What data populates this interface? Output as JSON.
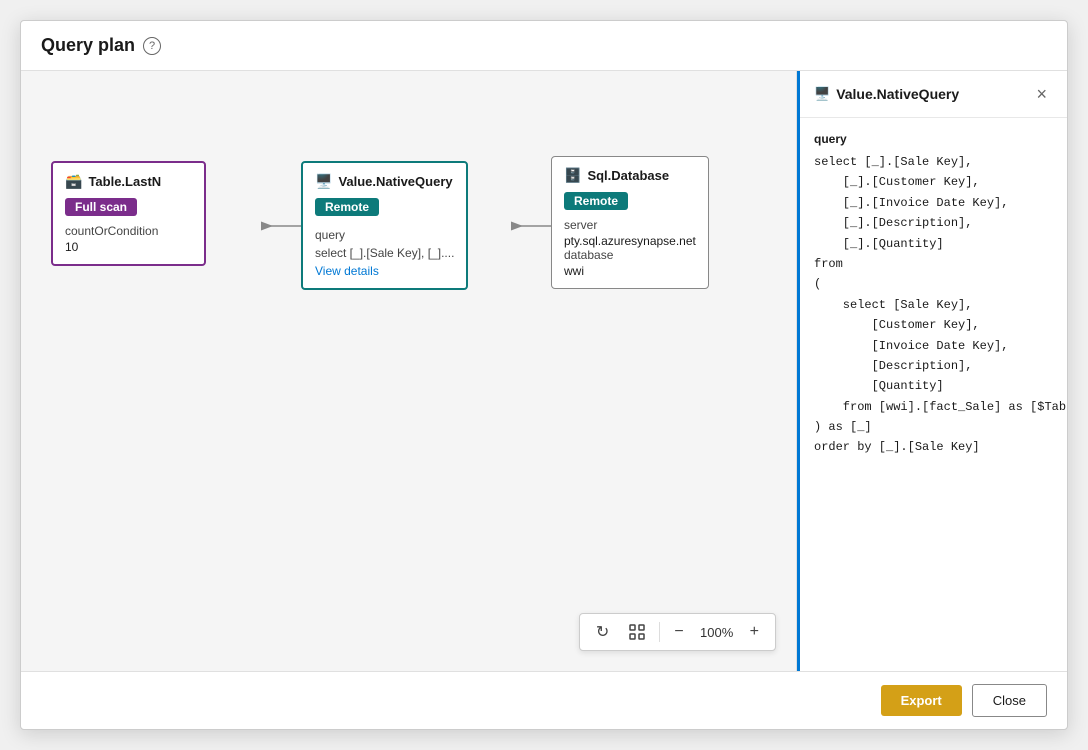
{
  "dialog": {
    "title": "Query plan",
    "help_tooltip": "?"
  },
  "footer": {
    "export_label": "Export",
    "close_label": "Close"
  },
  "canvas": {
    "zoom": "100%"
  },
  "nodes": [
    {
      "id": "table-lastn",
      "type": "table",
      "title": "Table.LastN",
      "badge": "Full scan",
      "badge_type": "fullscan",
      "fields": [
        {
          "label": "countOrCondition"
        },
        {
          "label": "10"
        }
      ]
    },
    {
      "id": "value-nativequery",
      "type": "value",
      "title": "Value.NativeQuery",
      "badge": "Remote",
      "badge_type": "remote",
      "query_label": "query",
      "query_preview": "select [_].[Sale Key], [_]....",
      "view_details": "View details"
    },
    {
      "id": "sql-database",
      "type": "sql",
      "title": "Sql.Database",
      "badge": "Remote",
      "badge_type": "remote",
      "server_label": "server",
      "server_value": "pty.sql.azuresynapse.net",
      "database_label": "database",
      "database_value": "wwi"
    }
  ],
  "right_panel": {
    "title": "Value.NativeQuery",
    "section_label": "query",
    "code": "select [_].[Sale Key],\n    [_].[Customer Key],\n    [_].[Invoice Date Key],\n    [_].[Description],\n    [_].[Quantity]\nfrom\n(\n    select [Sale Key],\n        [Customer Key],\n        [Invoice Date Key],\n        [Description],\n        [Quantity]\n    from [wwi].[fact_Sale] as [$Table]\n) as [_]\norder by [_].[Sale Key]"
  }
}
